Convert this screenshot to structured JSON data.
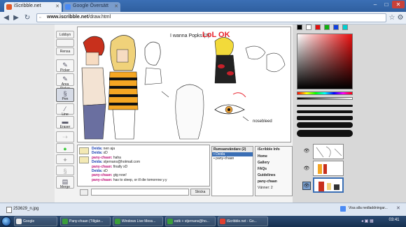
{
  "browser": {
    "tabs": [
      {
        "label": "iScribble.net"
      },
      {
        "label": "Google Översätt"
      }
    ],
    "address": {
      "domain": "www.iscribble.net",
      "path": "/draw.html"
    },
    "window_controls": [
      "–",
      "□",
      "✕"
    ]
  },
  "left_panel": {
    "buttons": [
      "Lobbyn",
      "Rensa"
    ],
    "tools": [
      "Picker",
      "Area Picker",
      "Pen",
      "Line",
      "Eraser",
      "Merge"
    ]
  },
  "canvas": {
    "texts": [
      "I wanna Popks (!!)",
      "LoL OK",
      "nosebleed"
    ]
  },
  "chat": {
    "messages": [
      {
        "nick": "Deida:",
        "text": "nen aja",
        "type": "d"
      },
      {
        "nick": "Deida:",
        "text": "xD",
        "type": "d"
      },
      {
        "nick": "pany-chaan:",
        "text": "haha",
        "type": "p"
      },
      {
        "nick": "Deida:",
        "text": "stjernans@hotmail.com",
        "type": "d"
      },
      {
        "nick": "pany-chaan:",
        "text": "finally xD",
        "type": "p"
      },
      {
        "nick": "Deida:",
        "text": "xD",
        "type": "d"
      },
      {
        "nick": "pany-chaan:",
        "text": "gtg now!",
        "type": "p"
      },
      {
        "nick": "pany-chaan:",
        "text": "has to sleep, or ill die tomorrow y.y",
        "type": "p"
      }
    ],
    "send_label": "Skicka",
    "input_value": ""
  },
  "users": {
    "header": "Rumsanvändare (2)",
    "list": [
      "Deida",
      "pany-chaan"
    ]
  },
  "info": {
    "header": "iScribble Info",
    "links": [
      "Home",
      "Gallery",
      "FAQs",
      "Guidelines",
      "pany-chaan"
    ],
    "friends": "Vänner: 2"
  },
  "palette": {
    "swatches": [
      "#000000",
      "#ffffff",
      "#e01010",
      "#10b010",
      "#1040e0",
      "#00d0d0"
    ],
    "current_color": "#e81010"
  },
  "download_bar": {
    "file": "253629_n.jpg",
    "show_all": "Visa alla nedladdningar..."
  },
  "taskbar": {
    "items": [
      {
        "label": "Google",
        "color": "#e8e8e8"
      },
      {
        "label": "Pany-chaan (Tillgän...",
        "color": "#3a9d3a"
      },
      {
        "label": "Windows Live Mess...",
        "color": "#3a9d3a"
      },
      {
        "label": "estk + stjernans@ho...",
        "color": "#3a9d3a"
      },
      {
        "label": "iScribble.net - Go...",
        "color": "#e04030"
      }
    ],
    "clock": "03:41"
  }
}
